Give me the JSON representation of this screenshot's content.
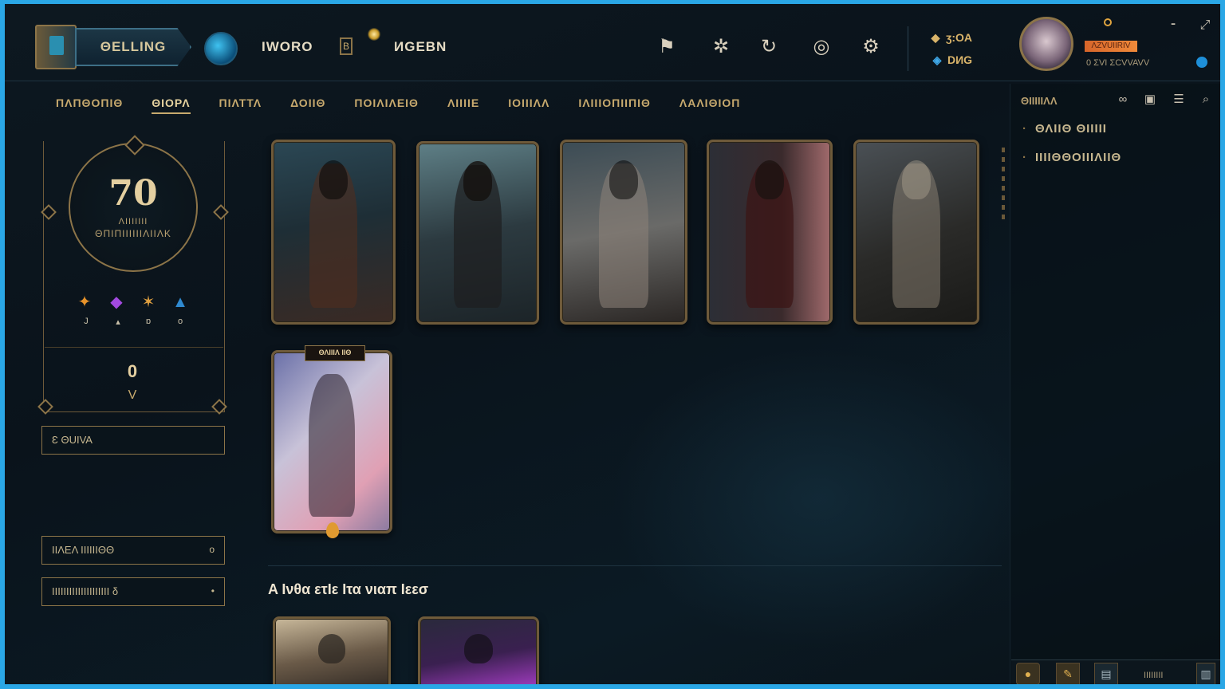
{
  "topbar": {
    "play_label": "ΘΕLLING",
    "nav_left": "IWORO",
    "nav_box": "B",
    "nav_right": "ИGEBN",
    "icons": [
      "trophy-icon",
      "sparkle-icon",
      "refresh-icon",
      "coin-icon",
      "settings-icon"
    ],
    "currency": [
      {
        "icon": "gem-icon",
        "value": "ӡ:OA"
      },
      {
        "icon": "blue-essence-icon",
        "value": "DИG"
      }
    ],
    "profile": {
      "name_bar": "ΛZVUIIRIV",
      "status": "0 ΣVI ΣCVVAVV"
    },
    "window_controls": [
      "minimize-icon",
      "close-icon"
    ]
  },
  "subnav": {
    "tabs": [
      "ΠΛΠΘΟΠΙΘ",
      "ΘΙΟΡΛ",
      "ΠΙΛΤΤΛ",
      "ΔΟΙΙΘ",
      "ΠΟΙΛΙΛΕΙΘ",
      "ΛΙΙΙΙΕ",
      "ΙΟΙΙΙΛΛ",
      "ΙΛΙΙΙΟΠΙΙΠΙΘ",
      "ΛΑΛΙΘΙΟΠ"
    ],
    "active_index": 1
  },
  "left": {
    "dial_value": "70",
    "dial_label_1": "ΛΙΙΙΙΙΙΙ",
    "dial_label_2": "ΘΠΙΠΙΙΙΙΙΙΛΙΙΛΚ",
    "runes": [
      {
        "icon": "orange-rune-icon",
        "value": "J"
      },
      {
        "icon": "purple-rune-icon",
        "value": "▴"
      },
      {
        "icon": "gold-rune-icon",
        "value": "ɒ"
      },
      {
        "icon": "blue-rune-icon",
        "value": "o"
      }
    ],
    "big_zero": "0",
    "chevron": "V",
    "button_1": "Ɛ ΘUIVA",
    "button_2": {
      "label": "ΙΙΛΕΛ ΙΙΙΙΙΙΘΘ",
      "value": "o"
    },
    "button_3": {
      "label": "ΙΙΙΙΙΙΙΙΙΙΙΙΙΙΙΙΙΙΙΙ δ",
      "value": "•"
    }
  },
  "cards": {
    "badge": "ΘΛΙΙΙΛ ΙΙΘ",
    "section_title": "A Ινθα ετΙε Ιτα νιαπ Ιεεσ"
  },
  "right": {
    "title": "ΘΙΙΙΙΙΛΛ",
    "icons": [
      "link-icon",
      "chat-icon",
      "list-icon",
      "search-icon"
    ],
    "items": [
      "ΘΛΙΙΘ ΘΙΙΙΙΙ",
      "ΙΙΙΙΘΘΟΙΙΙΛΙΙΘ"
    ],
    "bottom_text": "ΙΙΙΙΙΙΙΙ"
  },
  "colors": {
    "frame": "#2aa7e6",
    "gold": "#c8aa6e",
    "background": "#0b1118",
    "accent_orange": "#f08a3a"
  }
}
